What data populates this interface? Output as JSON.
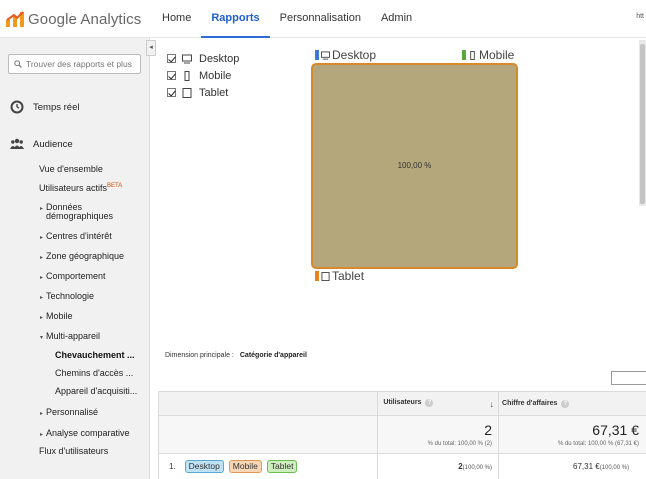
{
  "app": {
    "brand": "Google Analytics"
  },
  "topnav": [
    {
      "label": "Home",
      "active": false
    },
    {
      "label": "Rapports",
      "active": true
    },
    {
      "label": "Personnalisation",
      "active": false
    },
    {
      "label": "Admin",
      "active": false
    }
  ],
  "top_right_text": "htt",
  "search": {
    "placeholder": "Trouver des rapports et plus"
  },
  "sidebar": {
    "realtime": "Temps réel",
    "audience": "Audience",
    "items": {
      "overview": "Vue d'ensemble",
      "active_users": "Utilisateurs actifs",
      "beta": "BETA",
      "demographics_1": "Données",
      "demographics_2": "démographiques",
      "interests": "Centres d'intérêt",
      "geo": "Zone géographique",
      "behavior": "Comportement",
      "technology": "Technologie",
      "mobile": "Mobile",
      "multi_device": "Multi-appareil",
      "overlap": "Chevauchement ...",
      "paths": "Chemins d'accès ...",
      "attribution": "Appareil d'acquisiti...",
      "custom": "Personnalisé",
      "benchmark": "Analyse comparative",
      "user_flow": "Flux d'utilisateurs"
    }
  },
  "legend": [
    {
      "label": "Desktop",
      "checked": true,
      "icon": "desktop-icon"
    },
    {
      "label": "Mobile",
      "checked": true,
      "icon": "mobile-icon"
    },
    {
      "label": "Tablet",
      "checked": true,
      "icon": "tablet-icon"
    }
  ],
  "venn": {
    "desktop_label": "Desktop",
    "mobile_label": "Mobile",
    "tablet_label": "Tablet",
    "colors": {
      "desktop": "#3d78d6",
      "mobile": "#5aa83c",
      "tablet": "#e8821e",
      "box_fill": "#b4a77b",
      "box_border": "#d88a2a"
    },
    "overlap_pct": "100,00 %"
  },
  "dimension": {
    "label": "Dimension principale :",
    "value": "Catégorie d'appareil"
  },
  "table": {
    "headers": {
      "users": "Utilisateurs",
      "revenue": "Chiffre d'affaires",
      "help": "?"
    },
    "totals": {
      "users_value": "2",
      "users_sub": "% du total: 100,00 % (2)",
      "revenue_value": "67,31 €",
      "revenue_sub": "% du total: 100,00 % (67,31 €)"
    },
    "rows": [
      {
        "index": "1.",
        "tags": [
          {
            "label": "Desktop",
            "bg": "#bfe3f5",
            "border": "#5aa8d6"
          },
          {
            "label": "Mobile",
            "bg": "#f7d6b5",
            "border": "#e09a55"
          },
          {
            "label": "Tablet",
            "bg": "#cfeec0",
            "border": "#6dbb54"
          }
        ],
        "users": "2",
        "users_pct": "(100,00 %)",
        "revenue": "67,31 €",
        "revenue_pct": "(100,00 %)"
      }
    ]
  }
}
